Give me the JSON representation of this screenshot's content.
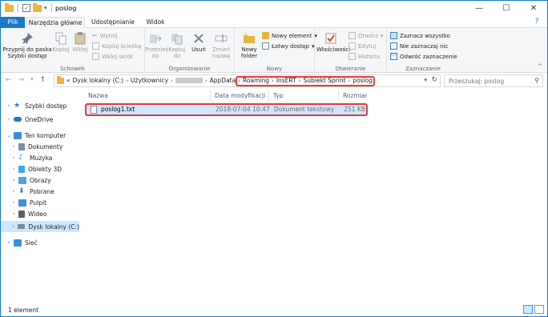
{
  "window": {
    "title": "poslog",
    "controls": {
      "minimize": "—",
      "maximize": "☐",
      "close": "✕"
    }
  },
  "ribbon_tabs": {
    "file": "Plik",
    "home": "Narzędzia główne",
    "share": "Udostępnianie",
    "view": "Widok",
    "help": "?"
  },
  "ribbon": {
    "schowek": {
      "label": "Schowek",
      "pin": "Przypnij do paska Szybki dostęp",
      "copy": "Kopiuj",
      "paste": "Wklej",
      "cut": "Wytnij",
      "copy_path": "Kopiuj ścieżkę",
      "paste_shortcut": "Wklej skrót"
    },
    "organizowanie": {
      "label": "Organizowanie",
      "move_to": "Przenieś do",
      "copy_to": "Kopiuj do",
      "delete": "Usuń",
      "rename": "Zmień nazwę"
    },
    "nowy": {
      "label": "Nowy",
      "new_folder": "Nowy folder",
      "new_item": "Nowy element",
      "easy_access": "Łatwy dostęp"
    },
    "otwieranie": {
      "label": "Otwieranie",
      "properties": "Właściwości",
      "open": "Otwórz",
      "edit": "Edytuj",
      "history": "Historia"
    },
    "zaznaczanie": {
      "label": "Zaznaczanie",
      "select_all": "Zaznacz wszystko",
      "select_none": "Nie zaznaczaj nic",
      "invert": "Odwróć zaznaczenie"
    }
  },
  "address": {
    "prefix": "«",
    "segments": [
      "Dysk lokalny (C:)",
      "Użytkownicy",
      "",
      "AppData",
      "Roaming",
      "InsERT",
      "Subiekt Sprint",
      "poslog"
    ],
    "search_placeholder": "Przeszukaj: poslog"
  },
  "navpane": {
    "items": [
      {
        "label": "Szybki dostęp",
        "color": "#2d7bd1"
      },
      {
        "label": "OneDrive",
        "color": "#1e78d6"
      },
      {
        "label": "Ten komputer",
        "color": "#3b8fd9"
      },
      {
        "label": "Dokumenty",
        "color": "#7a8ea8"
      },
      {
        "label": "Muzyka",
        "color": "#2a7bd2"
      },
      {
        "label": "Obiekty 3D",
        "color": "#43a6e8"
      },
      {
        "label": "Obrazy",
        "color": "#5aa0d8"
      },
      {
        "label": "Pobrane",
        "color": "#2a7bd2"
      },
      {
        "label": "Pulpit",
        "color": "#3d8fe0"
      },
      {
        "label": "Wideo",
        "color": "#555e6a"
      },
      {
        "label": "Dysk lokalny (C:)",
        "color": "#7d8b99"
      },
      {
        "label": "Sieć",
        "color": "#3b8fd9"
      }
    ]
  },
  "columns": {
    "name": "Nazwa",
    "date": "Data modyfikacji",
    "type": "Typ",
    "size": "Rozmiar"
  },
  "files": [
    {
      "name": "poslog1.txt",
      "date": "2018-07-04 10:47",
      "type": "Dokument tekstowy",
      "size": "251 KB"
    }
  ],
  "status": {
    "count": "1 element"
  },
  "colors": {
    "accent": "#1979ca",
    "selection": "#cce8ff",
    "highlight": "#e23b3b"
  }
}
